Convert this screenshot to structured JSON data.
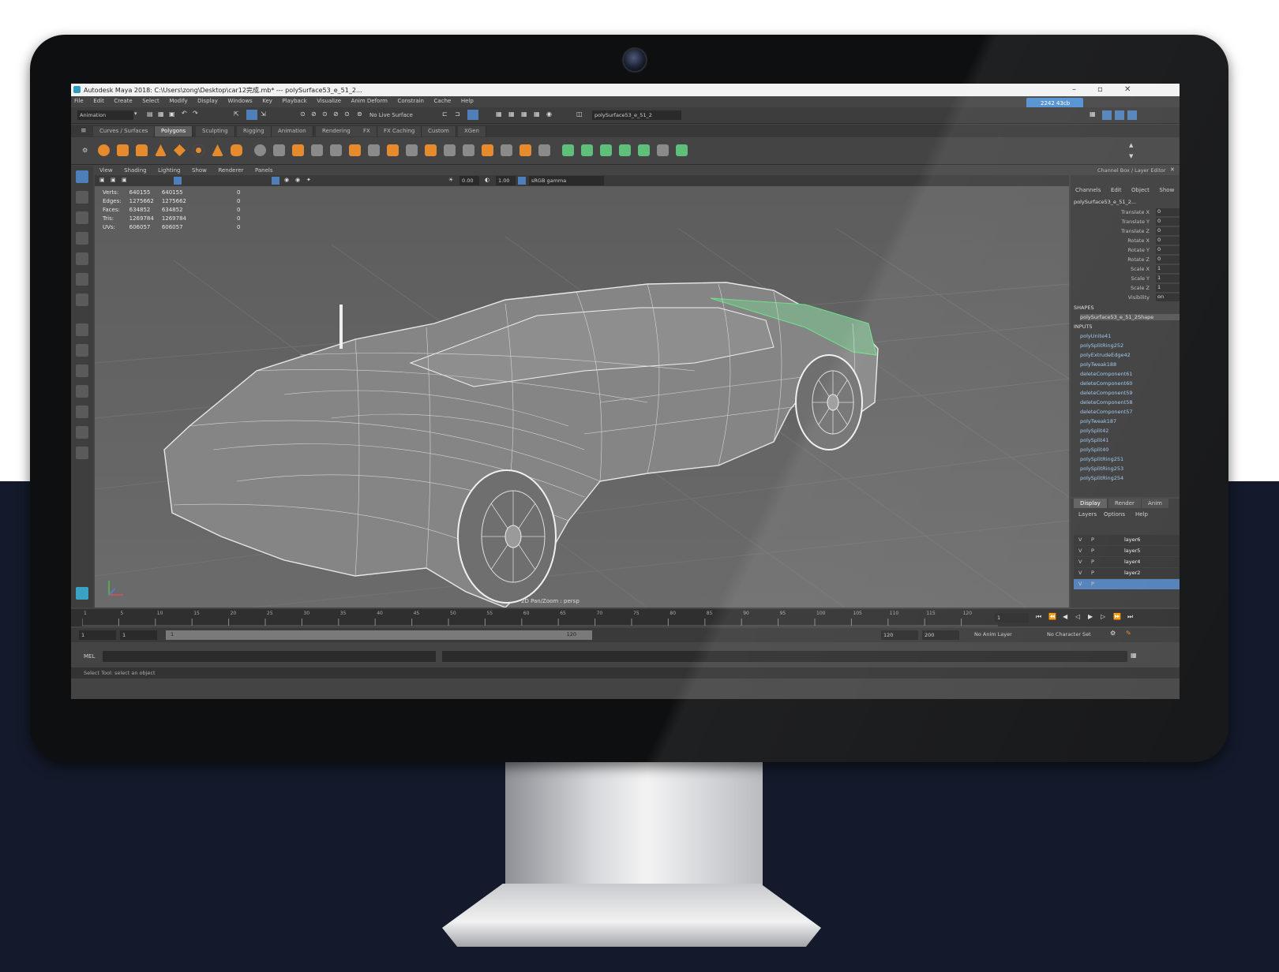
{
  "window": {
    "title": "Autodesk Maya 2018: C:\\Users\\zong\\Desktop\\car12完成.mb* --- polySurface53_e_51_2..."
  },
  "menubar": [
    "File",
    "Edit",
    "Create",
    "Select",
    "Modify",
    "Display",
    "Windows",
    "Key",
    "Playback",
    "Visualize",
    "Anim Deform",
    "Constrain",
    "Cache",
    "Help"
  ],
  "statusline": {
    "mode": "Animation",
    "live_surface": "No Live Surface",
    "object_field": "polySurface53_e_51_2",
    "account": "2242 43cb"
  },
  "shelf_tabs": [
    "Curves / Surfaces",
    "Polygons",
    "Sculpting",
    "Rigging",
    "Animation",
    "Rendering",
    "FX",
    "FX Caching",
    "Custom",
    "XGen"
  ],
  "viewport": {
    "menu": [
      "View",
      "Shading",
      "Lighting",
      "Show",
      "Renderer",
      "Panels"
    ],
    "toolbar": {
      "value1": "0.00",
      "value2": "1.00",
      "color_space": "sRGB gamma"
    },
    "hud": {
      "rows": [
        {
          "label": "Verts:",
          "a": "640155",
          "b": "640155",
          "c": "0"
        },
        {
          "label": "Edges:",
          "a": "1275662",
          "b": "1275662",
          "c": "0"
        },
        {
          "label": "Faces:",
          "a": "634852",
          "b": "634852",
          "c": "0"
        },
        {
          "label": "Tris:",
          "a": "1269784",
          "b": "1269784",
          "c": "0"
        },
        {
          "label": "UVs:",
          "a": "606057",
          "b": "606057",
          "c": "0"
        }
      ]
    },
    "camera_label": "2D Pan/Zoom : persp"
  },
  "channel_box": {
    "title": "Channel Box / Layer Editor",
    "menu": [
      "Channels",
      "Edit",
      "Object",
      "Show"
    ],
    "object_name": "polySurface53_e_51_2...",
    "channels": [
      {
        "label": "Translate X",
        "value": "0"
      },
      {
        "label": "Translate Y",
        "value": "0"
      },
      {
        "label": "Translate Z",
        "value": "0"
      },
      {
        "label": "Rotate X",
        "value": "0"
      },
      {
        "label": "Rotate Y",
        "value": "0"
      },
      {
        "label": "Rotate Z",
        "value": "0"
      },
      {
        "label": "Scale X",
        "value": "1"
      },
      {
        "label": "Scale Y",
        "value": "1"
      },
      {
        "label": "Scale Z",
        "value": "1"
      },
      {
        "label": "Visibility",
        "value": "on"
      }
    ],
    "shapes_label": "SHAPES",
    "shape_name": "polySurface53_e_51_2Shape",
    "inputs_label": "INPUTS",
    "inputs": [
      "polyUnite41",
      "polySplitRing252",
      "polyExtrudeEdge42",
      "polyTweak188",
      "deleteComponent61",
      "deleteComponent60",
      "deleteComponent59",
      "deleteComponent58",
      "deleteComponent57",
      "polyTweak187",
      "polySplit42",
      "polySplit41",
      "polySplit40",
      "polySplitRing251",
      "polySplitRing253",
      "polySplitRing254"
    ]
  },
  "layer_editor": {
    "tabs": [
      "Display",
      "Render",
      "Anim"
    ],
    "menu": [
      "Layers",
      "Options",
      "Help"
    ],
    "layers": [
      {
        "v": "V",
        "p": "P",
        "name": "layer6"
      },
      {
        "v": "V",
        "p": "P",
        "name": "layer5"
      },
      {
        "v": "V",
        "p": "P",
        "name": "layer4"
      },
      {
        "v": "V",
        "p": "P",
        "name": "layer2"
      },
      {
        "v": "V",
        "p": "P",
        "name": ""
      }
    ]
  },
  "time_slider": {
    "ticks": [
      "1",
      "5",
      "10",
      "15",
      "20",
      "25",
      "30",
      "35",
      "40",
      "45",
      "50",
      "55",
      "60",
      "65",
      "70",
      "75",
      "80",
      "85",
      "90",
      "95",
      "100",
      "105",
      "110",
      "115",
      "120"
    ],
    "current_frame": "1"
  },
  "range_slider": {
    "start": "1",
    "start2": "1",
    "range_start_label": "1",
    "range_end_label": "120",
    "end": "120",
    "end2": "200",
    "anim_layer": "No Anim Layer",
    "character_set": "No Character Set"
  },
  "command_line": {
    "label": "MEL"
  },
  "help_line": {
    "text": "Select Tool: select an object"
  },
  "colors": {
    "background_dark": "#141a2b",
    "maya_panel": "#444444",
    "accent_green": "#5fbf7a",
    "shelf_orange": "#e58a2d"
  }
}
